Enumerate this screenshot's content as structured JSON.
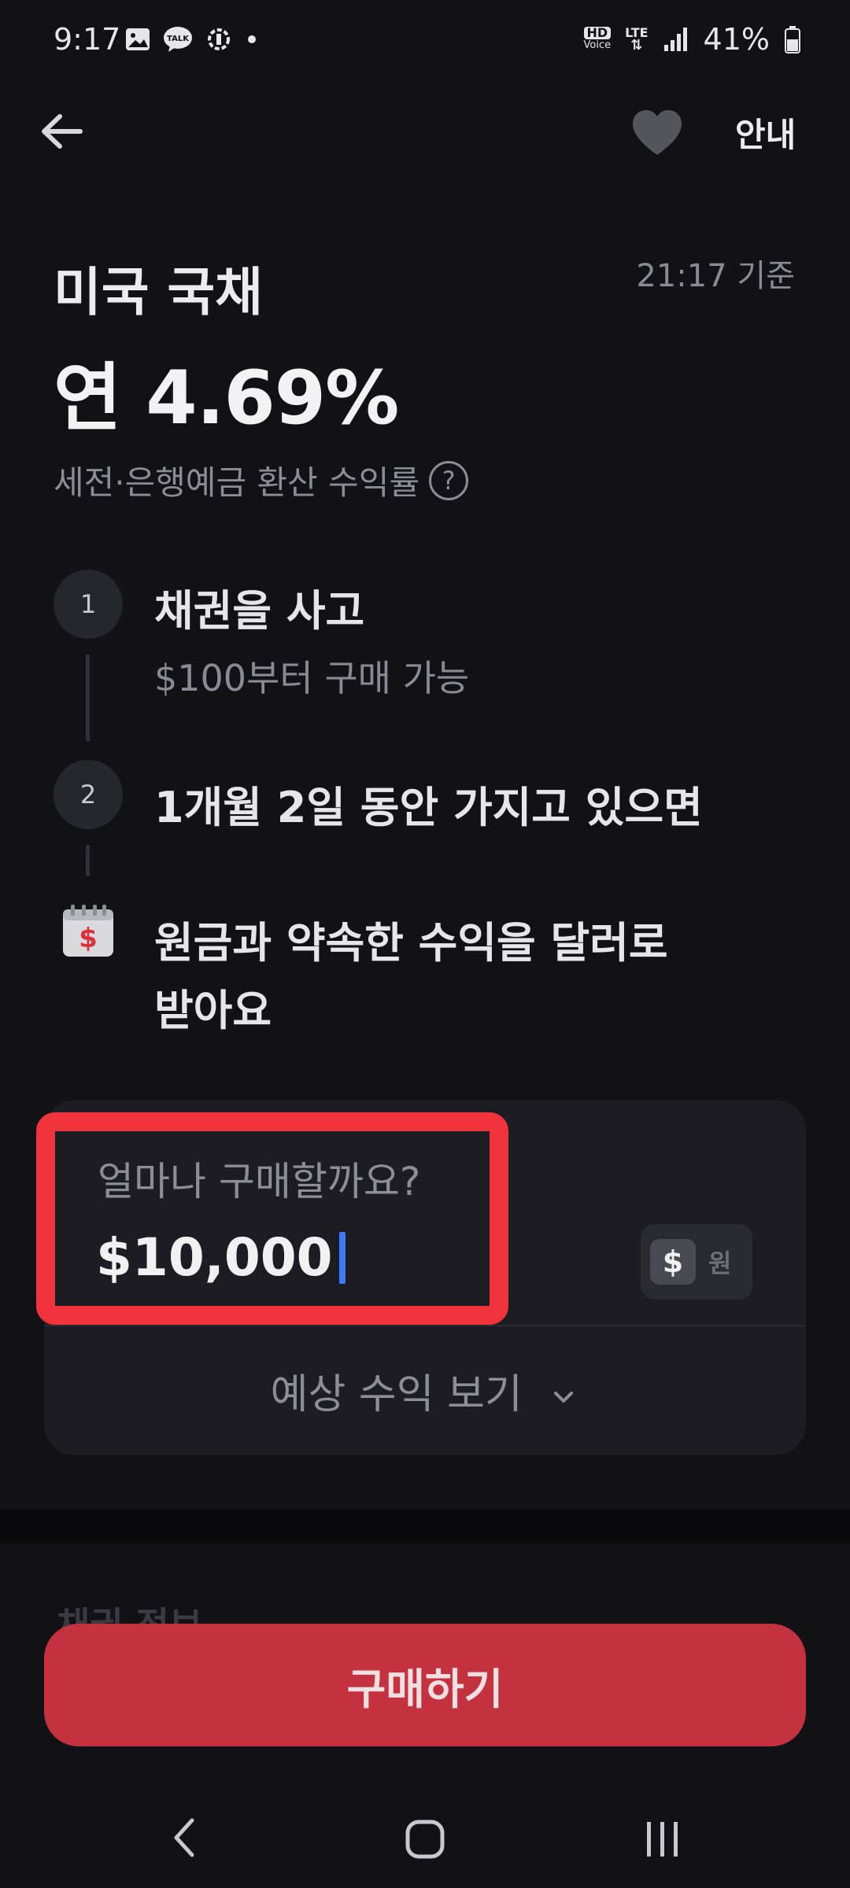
{
  "status_bar": {
    "time": "9:17",
    "battery": "41%",
    "talk_badge": "TALK",
    "hd_label": "HD",
    "voice_label": "Voice",
    "lte_label": "LTE"
  },
  "nav": {
    "info_label": "안내"
  },
  "product": {
    "title": "미국 국채",
    "basis_time": "21:17 기준",
    "rate": "연 4.69%",
    "rate_note": "세전·은행예금 환산 수익률",
    "help_glyph": "?"
  },
  "steps": [
    {
      "number": "1",
      "title": "채권을 사고",
      "subtitle": "$100부터 구매 가능"
    },
    {
      "number": "2",
      "title": "1개월 2일 동안 가지고 있으면"
    },
    {
      "title_line1": "원금과 약속한 수익을 달러로",
      "title_line2": "받아요"
    }
  ],
  "purchase": {
    "prompt": "얼마나 구매할까요?",
    "amount": "$10,000",
    "currency_usd": "$",
    "currency_krw": "원",
    "expected_label": "예상 수익 보기",
    "cut_section_title": "채권 정보"
  },
  "buy_button": "구매하기",
  "colors": {
    "background": "#111116",
    "card": "#1c1c22",
    "accent_button": "#c4323f",
    "highlight": "#f1333b",
    "caret": "#3d7af5"
  }
}
